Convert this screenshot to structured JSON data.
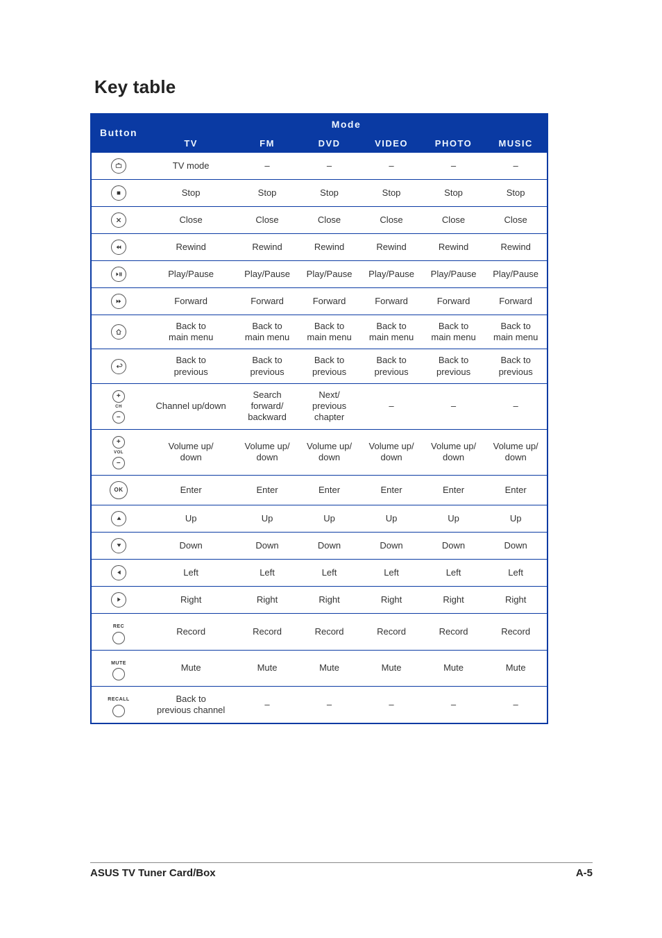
{
  "page_title": "Key table",
  "footer_left": "ASUS TV Tuner Card/Box",
  "footer_right": "A-5",
  "headers": {
    "button": "Button",
    "mode": "Mode",
    "modes": [
      "TV",
      "FM",
      "DVD",
      "VIDEO",
      "PHOTO",
      "MUSIC"
    ]
  },
  "rows": [
    {
      "button_name": "tv-mode-icon",
      "icon": "tv",
      "cells": [
        "TV mode",
        "–",
        "–",
        "–",
        "–",
        "–"
      ]
    },
    {
      "button_name": "stop-icon",
      "icon": "stop",
      "cells": [
        "Stop",
        "Stop",
        "Stop",
        "Stop",
        "Stop",
        "Stop"
      ]
    },
    {
      "button_name": "close-icon",
      "icon": "close",
      "cells": [
        "Close",
        "Close",
        "Close",
        "Close",
        "Close",
        "Close"
      ]
    },
    {
      "button_name": "rewind-icon",
      "icon": "rewind",
      "cells": [
        "Rewind",
        "Rewind",
        "Rewind",
        "Rewind",
        "Rewind",
        "Rewind"
      ]
    },
    {
      "button_name": "play-pause-icon",
      "icon": "playpause",
      "cells": [
        "Play/Pause",
        "Play/Pause",
        "Play/Pause",
        "Play/Pause",
        "Play/Pause",
        "Play/Pause"
      ]
    },
    {
      "button_name": "forward-icon",
      "icon": "forward",
      "cells": [
        "Forward",
        "Forward",
        "Forward",
        "Forward",
        "Forward",
        "Forward"
      ]
    },
    {
      "button_name": "home-icon",
      "icon": "home",
      "cells": [
        "Back to\nmain menu",
        "Back to\nmain menu",
        "Back to\nmain menu",
        "Back to\nmain menu",
        "Back to\nmain menu",
        "Back to\nmain menu"
      ]
    },
    {
      "button_name": "back-icon",
      "icon": "return",
      "cells": [
        "Back to\nprevious",
        "Back to\nprevious",
        "Back to\nprevious",
        "Back to\nprevious",
        "Back to\nprevious",
        "Back to\nprevious"
      ]
    },
    {
      "button_name": "channel-up-down-icon",
      "icon": "ch-pair",
      "cells": [
        "Channel up/down",
        "Search\nforward/\nbackward",
        "Next/\nprevious\nchapter",
        "–",
        "–",
        "–"
      ]
    },
    {
      "button_name": "volume-up-down-icon",
      "icon": "vol-pair",
      "cells": [
        "Volume up/\ndown",
        "Volume up/\ndown",
        "Volume up/\ndown",
        "Volume up/\ndown",
        "Volume up/\ndown",
        "Volume up/\ndown"
      ]
    },
    {
      "button_name": "ok-icon",
      "icon": "ok",
      "ok_label": "OK",
      "cells": [
        "Enter",
        "Enter",
        "Enter",
        "Enter",
        "Enter",
        "Enter"
      ]
    },
    {
      "button_name": "up-icon",
      "icon": "up",
      "cells": [
        "Up",
        "Up",
        "Up",
        "Up",
        "Up",
        "Up"
      ]
    },
    {
      "button_name": "down-icon",
      "icon": "down",
      "cells": [
        "Down",
        "Down",
        "Down",
        "Down",
        "Down",
        "Down"
      ]
    },
    {
      "button_name": "left-icon",
      "icon": "left",
      "cells": [
        "Left",
        "Left",
        "Left",
        "Left",
        "Left",
        "Left"
      ]
    },
    {
      "button_name": "right-icon",
      "icon": "right",
      "cells": [
        "Right",
        "Right",
        "Right",
        "Right",
        "Right",
        "Right"
      ]
    },
    {
      "button_name": "record-icon",
      "icon": "rec",
      "rec_label": "REC",
      "cells": [
        "Record",
        "Record",
        "Record",
        "Record",
        "Record",
        "Record"
      ]
    },
    {
      "button_name": "mute-icon",
      "icon": "mute",
      "rec_label": "MUTE",
      "cells": [
        "Mute",
        "Mute",
        "Mute",
        "Mute",
        "Mute",
        "Mute"
      ]
    },
    {
      "button_name": "recall-icon",
      "icon": "recall",
      "rec_label": "RECALL",
      "cells": [
        "Back to\nprevious channel",
        "–",
        "–",
        "–",
        "–",
        "–"
      ]
    }
  ],
  "pair_labels": {
    "plus": "+",
    "minus": "–",
    "ch": "CH",
    "vol": "VOL"
  }
}
